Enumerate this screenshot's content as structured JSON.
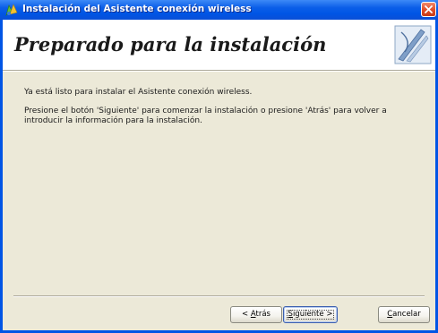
{
  "window": {
    "title": "Instalación del Asistente conexión wireless"
  },
  "header": {
    "title": "Preparado para la instalación"
  },
  "content": {
    "line1": "Ya está listo para instalar el Asistente conexión wireless.",
    "line2": "Presione el botón 'Siguiente' para comenzar la instalación o presione 'Atrás' para volver a introducir la información para la instalación."
  },
  "buttons": {
    "back": {
      "prefix": "< ",
      "mnemonic": "A",
      "rest": "trás"
    },
    "next": {
      "mnemonic": "S",
      "rest": "iguiente >"
    },
    "cancel": {
      "mnemonic": "C",
      "rest": "ancelar"
    }
  },
  "colors": {
    "titlebar": "#0055e5",
    "dialog_bg": "#ece9d8",
    "close_button": "#e2502a"
  },
  "icons": {
    "app": "installer-icon",
    "close": "close-icon",
    "header_graphic": "wizard-graphic-icon"
  }
}
